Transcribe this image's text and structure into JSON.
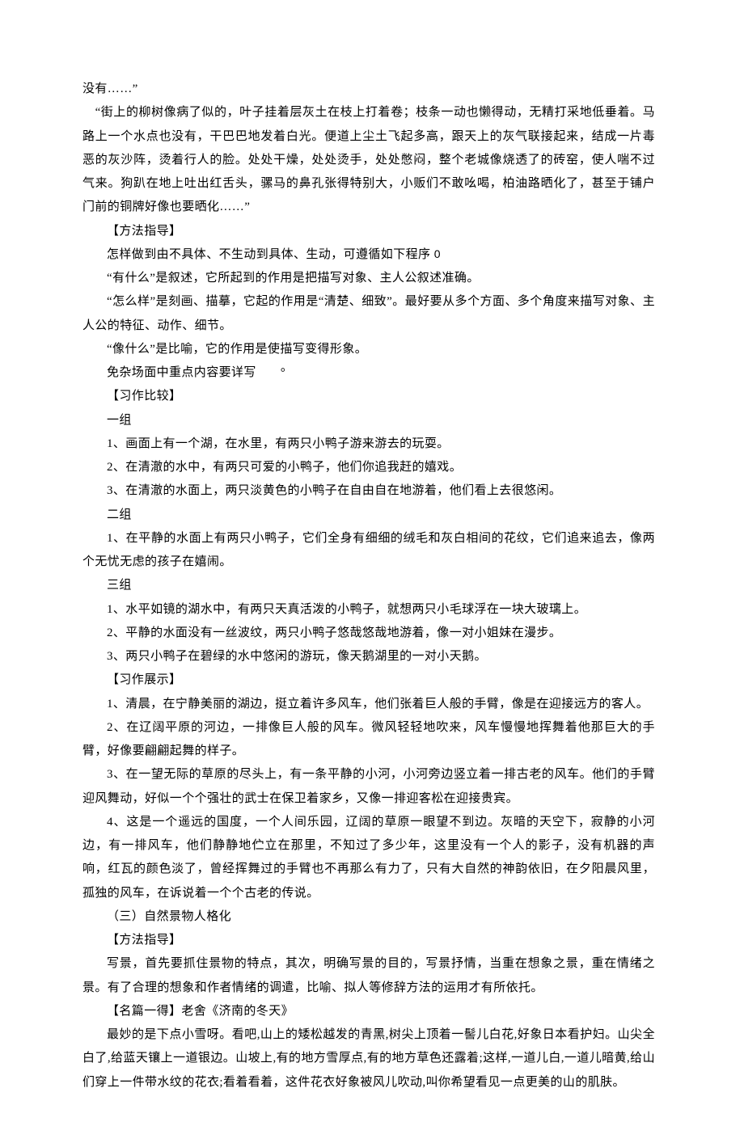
{
  "lines": [
    {
      "text": "没有……”",
      "noIndent": true
    },
    {
      "text": "　“街上的柳树像病了似的，叶子挂着层灰土在枝上打着卷；枝条一动也懒得动，无精打采地低垂着。马路上一个水点也没有，干巴巴地发着白光。便道上尘土飞起多高，跟天上的灰气联接起来，结成一片毒恶的灰沙阵，烫着行人的脸。处处干燥，处处烫手，处处憋闷，整个老城像烧透了的砖窑，使人喘不过气来。狗趴在地上吐出红舌头，骡马的鼻孔张得特别大，小贩们不敢吆喝，柏油路晒化了，甚至于铺户门前的铜牌好像也要晒化……”",
      "noIndent": true
    },
    {
      "text": "【方法指导】"
    },
    {
      "text": "怎样做到由不具体、不生动到具体、生动，可遵循如下程序",
      "noIndent": false,
      "appendZero": true
    },
    {
      "text": "“有什么”是叙述，它所起到的作用是把描写对象、主人公叙述准确。"
    },
    {
      "text": "“怎么样”是刻画、描摹，它起的作用是“清楚、细致”。最好要从多个方面、多个角度来描写对象、主人公的特征、动作、细节。",
      "noIndent": false,
      "wrapNoIndent": true
    },
    {
      "text": "“像什么”是比喻，它的作用是使描写变得形象。"
    },
    {
      "text": "免杂场面中重点内容要详写",
      "supDot": true
    },
    {
      "text": "【习作比较】"
    },
    {
      "text": "一组"
    },
    {
      "text": "1、画面上有一个湖，在水里，有两只小鸭子游来游去的玩耍。"
    },
    {
      "text": "2、在清澈的水中，有两只可爱的小鸭子，他们你追我赶的嬉戏。"
    },
    {
      "text": "3、在清澈的水面上，两只淡黄色的小鸭子在自由自在地游着，他们看上去很悠闲。"
    },
    {
      "text": "二组"
    },
    {
      "text": "1、在平静的水面上有两只小鸭子，它们全身有细细的绒毛和灰白相间的花纹，它们追来追去，像两个无忧无虑的孩子在嬉闹。",
      "wrapNoIndent": true
    },
    {
      "text": "三组"
    },
    {
      "text": "1、水平如镜的湖水中，有两只天真活泼的小鸭子，就想两只小毛球浮在一块大玻璃上。"
    },
    {
      "text": "2、平静的水面没有一丝波纹，两只小鸭子悠哉悠哉地游着，像一对小姐妹在漫步。"
    },
    {
      "text": "3、两只小鸭子在碧绿的水中悠闲的游玩，像天鹅湖里的一对小天鹅。"
    },
    {
      "text": "【习作展示】"
    },
    {
      "text": "1、清晨，在宁静美丽的湖边，挺立着许多风车，他们张着巨人般的手臂，像是在迎接远方的客人。"
    },
    {
      "text": "2、在辽阔平原的河边，一排像巨人般的风车。微风轻轻地吹来，风车慢慢地挥舞着他那巨大的手臂，好像要翩翩起舞的样子。",
      "wrapNoIndent": true
    },
    {
      "text": "3、在一望无际的草原的尽头上，有一条平静的小河，小河旁边竖立着一排古老的风车。他们的手臂迎风舞动，好似一个个强壮的武士在保卫着家乡，又像一排迎客松在迎接贵宾。",
      "wrapNoIndent": true
    },
    {
      "text": "4、这是一个遥远的国度，一个人间乐园，辽阔的草原一眼望不到边。灰暗的天空下，寂静的小河边，有一排风车，他们静静地伫立在那里，不知过了多少年，这里没有一个人的影子，没有机器的声响，红瓦的颜色淡了，曾经挥舞过的手臂也不再那么有力了，只有大自然的神韵依旧，在夕阳晨风里，孤独的风车，在诉说着一个个古老的传说。",
      "wrapNoIndent": true
    },
    {
      "text": "（三）自然景物人格化"
    },
    {
      "text": "【方法指导】"
    },
    {
      "text": "写景，首先要抓住景物的特点，其次，明确写景的目的，写景抒情，当重在想象之景，重在情绪之景。有了合理的想象和作者情绪的调遣，比喻、拟人等修辞方法的运用才有所依托。",
      "wrapNoIndent": true
    },
    {
      "text": "【名篇一得】老舍《济南的冬天》"
    },
    {
      "text": "最妙的是下点小雪呀。看吧,山上的矮松越发的青黑,树尖上顶着一髻儿白花,好象日本看护妇。山尖全白了,给蓝天镶上一道银边。山坡上,有的地方雪厚点,有的地方草色还露着;这样,一道儿白,一道儿暗黄,给山们穿上一件带水纹的花衣;看着看着，这件花衣好象被风儿吹动,叫你希望看见一点更美的山的肌肤。",
      "wrapNoIndent": true
    }
  ]
}
